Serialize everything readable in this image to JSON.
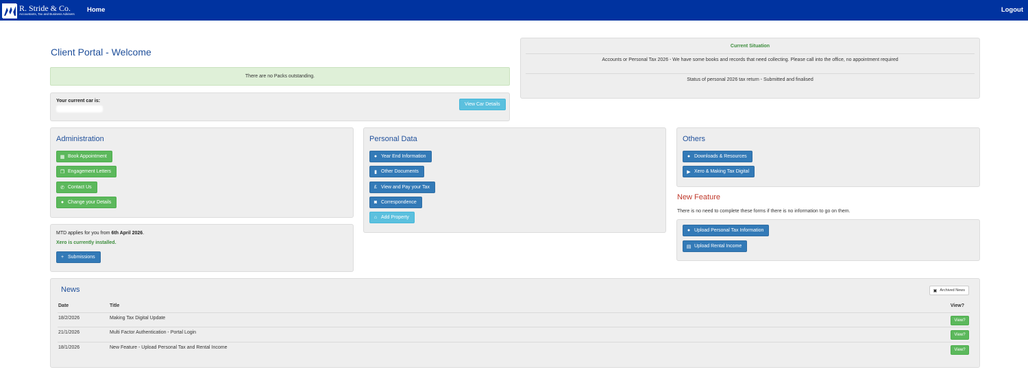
{
  "nav": {
    "logo_name": "R. Stride & Co.",
    "logo_tagline": "Accountants, Tax and Business Advisers",
    "home": "Home",
    "logout": "Logout"
  },
  "page_title": "Client Portal - Welcome",
  "packs_alert": "There are no Packs outstanding.",
  "car": {
    "label": "Your current car is:",
    "button": "View Car Details"
  },
  "situation": {
    "title": "Current Situation",
    "line1": "Accounts or Personal Tax 2026 - We have some books and records that need collecting. Please call into the office, no appointment required",
    "line2": "Status of personal 2026 tax return - Submitted and finalised"
  },
  "administration": {
    "title": "Administration",
    "buttons": [
      {
        "label": "Book Appointment",
        "icon": "calendar-icon"
      },
      {
        "label": "Engagement Letters",
        "icon": "documents-icon"
      },
      {
        "label": "Contact Us",
        "icon": "phone-icon"
      },
      {
        "label": "Change your Details",
        "icon": "user-icon"
      }
    ]
  },
  "mtd": {
    "prefix": "MTD applies for you from ",
    "date": "6th April 2026",
    "suffix": ".",
    "status": "Xero is currently installed.",
    "button": "Submissions"
  },
  "personal_data": {
    "title": "Personal Data",
    "buttons": [
      {
        "label": "Year End Information",
        "icon": "info-icon"
      },
      {
        "label": "Other Documents",
        "icon": "file-icon"
      },
      {
        "label": "View and Pay your Tax",
        "icon": "pound-icon"
      },
      {
        "label": "Correspondence",
        "icon": "comments-icon"
      },
      {
        "label": "Add Property",
        "icon": "home-icon"
      }
    ]
  },
  "others": {
    "title": "Others",
    "buttons": [
      {
        "label": "Downloads & Resources",
        "icon": "info-icon"
      },
      {
        "label": "Xero & Making Tax Digital",
        "icon": "video-icon"
      }
    ]
  },
  "new_feature": {
    "title": "New Feature",
    "note": "There is no need to complete these forms if there is no information to go on them.",
    "buttons": [
      {
        "label": "Upload Personal Tax Information",
        "icon": "info-icon"
      },
      {
        "label": "Upload Rental Income",
        "icon": "document-icon"
      }
    ]
  },
  "news": {
    "title": "News",
    "archived": "Archived News",
    "columns": {
      "date": "Date",
      "title": "Title",
      "view": "View?"
    },
    "rows": [
      {
        "date": "18/2/2026",
        "title": "Making Tax Digital Update",
        "view": "View?"
      },
      {
        "date": "21/1/2026",
        "title": "Multi Factor Authentication - Portal Login",
        "view": "View?"
      },
      {
        "date": "18/1/2026",
        "title": "New Feature - Upload Personal Tax and Rental Income",
        "view": "View?"
      }
    ]
  },
  "colors": {
    "navbar": "#0033a0",
    "heading": "#1f4f9a",
    "success": "#5cb85c",
    "primary": "#337ab7",
    "info": "#5bc0de",
    "danger_heading": "#c0392b"
  }
}
